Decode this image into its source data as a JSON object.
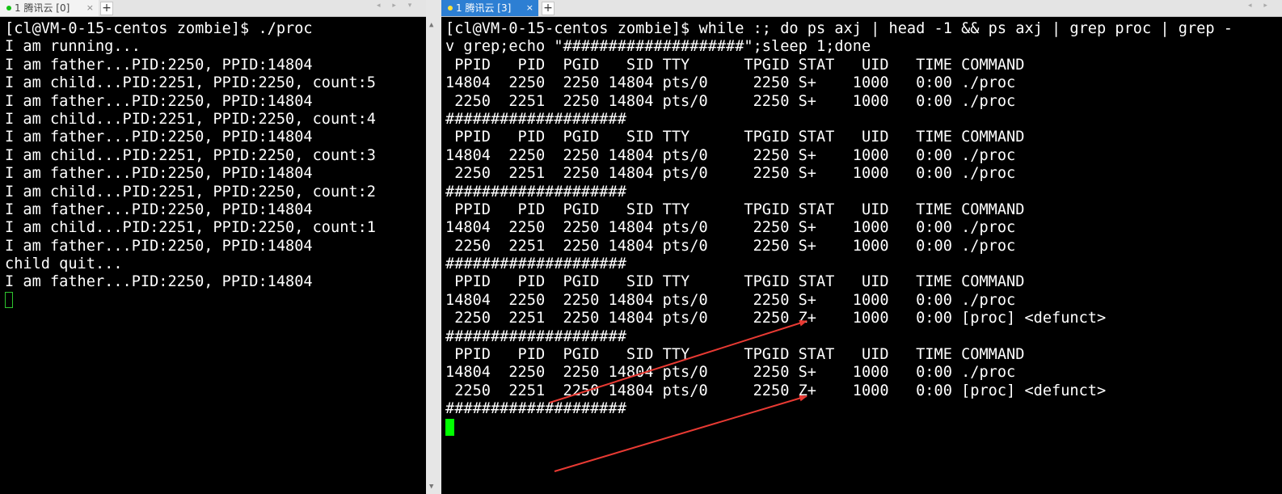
{
  "left_tab": {
    "label": "1 腾讯云 [0]",
    "close": "×",
    "add": "+"
  },
  "right_tab": {
    "label": "1 腾讯云 [3]",
    "close": "×",
    "add": "+"
  },
  "nav": {
    "arrows": "◂ ▸ ▾",
    "arrows_right": "◂ ▸"
  },
  "divider": {
    "up": "▲",
    "down": "▼"
  },
  "colors": {
    "active_tab": "#2d7fd3",
    "cursor": "#00ff00",
    "arrow": "#e83a33"
  },
  "left_terminal": {
    "lines": [
      "[cl@VM-0-15-centos zombie]$ ./proc",
      "I am running...",
      "I am father...PID:2250, PPID:14804",
      "I am child...PID:2251, PPID:2250, count:5",
      "I am father...PID:2250, PPID:14804",
      "I am child...PID:2251, PPID:2250, count:4",
      "I am father...PID:2250, PPID:14804",
      "I am child...PID:2251, PPID:2250, count:3",
      "I am father...PID:2250, PPID:14804",
      "I am child...PID:2251, PPID:2250, count:2",
      "I am father...PID:2250, PPID:14804",
      "I am child...PID:2251, PPID:2250, count:1",
      "I am father...PID:2250, PPID:14804",
      "child quit...",
      "I am father...PID:2250, PPID:14804"
    ]
  },
  "right_terminal": {
    "lines": [
      "[cl@VM-0-15-centos zombie]$ while :; do ps axj | head -1 && ps axj | grep proc | grep -",
      "v grep;echo \"####################\";sleep 1;done",
      " PPID   PID  PGID   SID TTY      TPGID STAT   UID   TIME COMMAND",
      "14804  2250  2250 14804 pts/0     2250 S+    1000   0:00 ./proc",
      " 2250  2251  2250 14804 pts/0     2250 S+    1000   0:00 ./proc",
      "####################",
      " PPID   PID  PGID   SID TTY      TPGID STAT   UID   TIME COMMAND",
      "14804  2250  2250 14804 pts/0     2250 S+    1000   0:00 ./proc",
      " 2250  2251  2250 14804 pts/0     2250 S+    1000   0:00 ./proc",
      "####################",
      " PPID   PID  PGID   SID TTY      TPGID STAT   UID   TIME COMMAND",
      "14804  2250  2250 14804 pts/0     2250 S+    1000   0:00 ./proc",
      " 2250  2251  2250 14804 pts/0     2250 S+    1000   0:00 ./proc",
      "####################",
      " PPID   PID  PGID   SID TTY      TPGID STAT   UID   TIME COMMAND",
      "14804  2250  2250 14804 pts/0     2250 S+    1000   0:00 ./proc",
      " 2250  2251  2250 14804 pts/0     2250 Z+    1000   0:00 [proc] <defunct>",
      "####################",
      " PPID   PID  PGID   SID TTY      TPGID STAT   UID   TIME COMMAND",
      "14804  2250  2250 14804 pts/0     2250 S+    1000   0:00 ./proc",
      " 2250  2251  2250 14804 pts/0     2250 Z+    1000   0:00 [proc] <defunct>",
      "####################"
    ]
  }
}
